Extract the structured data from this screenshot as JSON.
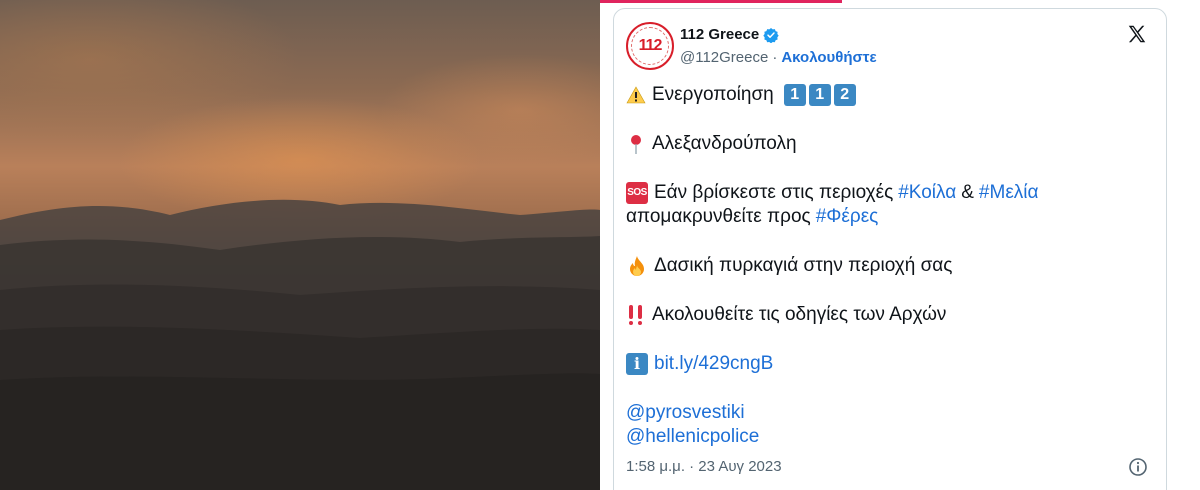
{
  "accent": "#1d6fd6",
  "brand_red": "#d81e2a",
  "photo": {
    "icon": "wildfire-photo",
    "alt": ""
  },
  "tweet": {
    "avatar_text": "112",
    "display_name": "112 Greece",
    "handle": "@112Greece",
    "separator": "·",
    "follow_label": "Ακολουθήστε",
    "line1_text": "Ενεργοποίηση",
    "line1_digits": [
      "1",
      "1",
      "2"
    ],
    "line2_text": "Αλεξανδρούπολη",
    "sos_label": "SOS",
    "line3_text_a": "Εάν βρίσκεστε στις περιοχές",
    "line3_hashtag_1": "#Κοίλα",
    "line3_amp": "&",
    "line3_hashtag_2": "#Μελία",
    "line4_text": "απομακρυνθείτε προς",
    "line4_hashtag": "#Φέρες",
    "line5_text": "Δασική πυρκαγιά στην περιοχή σας",
    "line6_text": "Ακολουθείτε τις οδηγίες των Αρχών",
    "info_label": "i",
    "link": "bit.ly/429cngB",
    "mention_1": "@pyrosvestiki",
    "mention_2": "@hellenicpolice",
    "timestamp": "1:58 μ.μ. · 23 Αυγ 2023"
  }
}
